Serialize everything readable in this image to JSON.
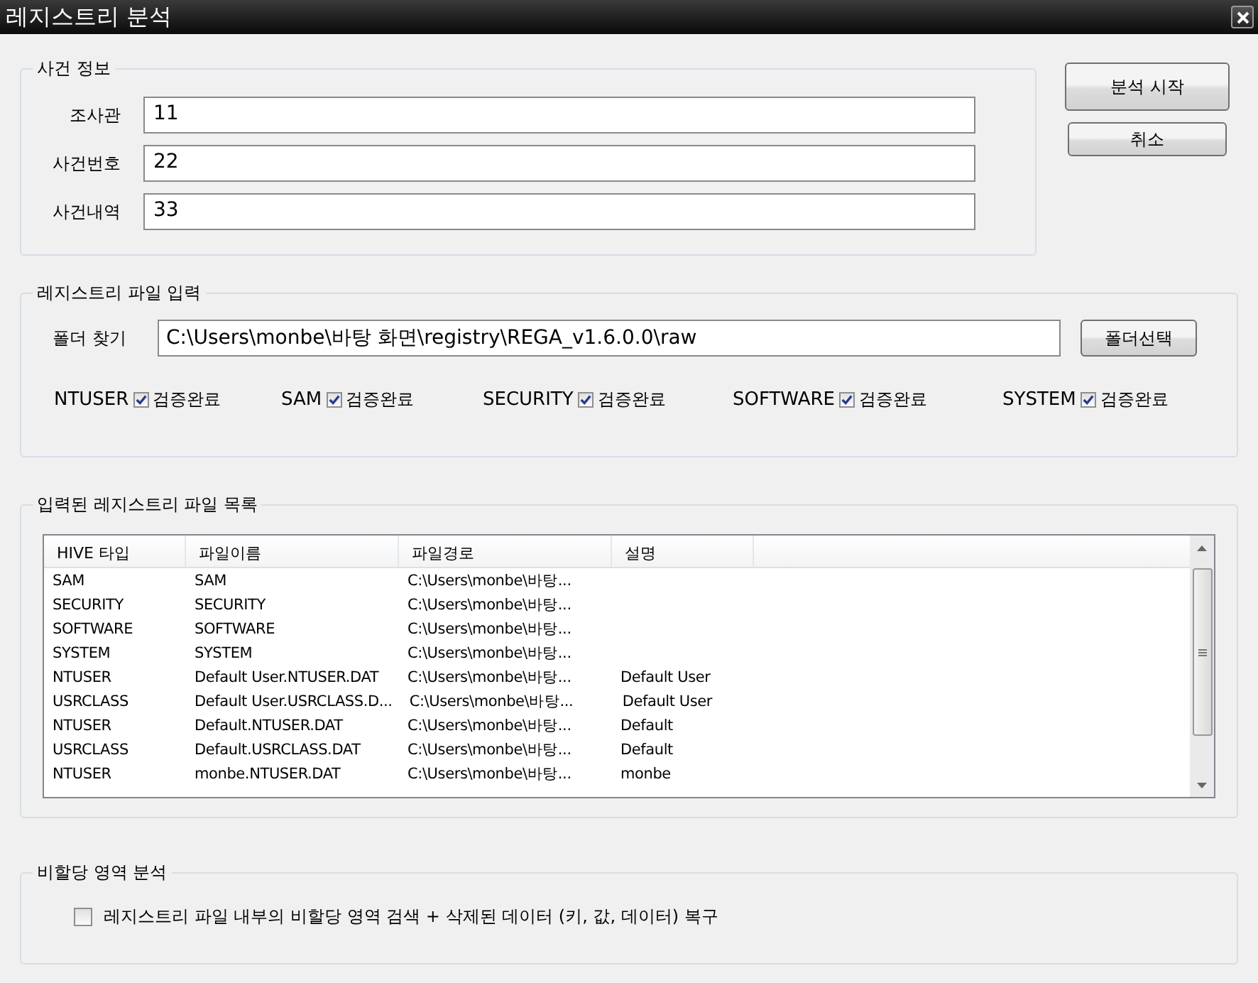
{
  "window": {
    "title": "레지스트리 분석"
  },
  "case_info": {
    "title": "사건 정보",
    "fields": [
      {
        "label": "조사관",
        "value": "11"
      },
      {
        "label": "사건번호",
        "value": "22"
      },
      {
        "label": "사건내역",
        "value": "33"
      }
    ]
  },
  "buttons": [
    {
      "label": "분석 시작"
    },
    {
      "label": "취소"
    }
  ],
  "file_input": {
    "title": "레지스트리 파일 입력",
    "folder_label": "폴더 찾기",
    "folder_value": "C:\\Users\\monbe\\바탕 화면\\registry\\REGA_v1.6.0.0\\raw",
    "folder_button": "폴더선택",
    "hives": [
      {
        "name": "NTUSER",
        "checked": true,
        "check_label": "검증완료"
      },
      {
        "name": "SAM",
        "checked": true,
        "check_label": "검증완료"
      },
      {
        "name": "SECURITY",
        "checked": true,
        "check_label": "검증완료"
      },
      {
        "name": "SOFTWARE",
        "checked": true,
        "check_label": "검증완료"
      },
      {
        "name": "SYSTEM",
        "checked": true,
        "check_label": "검증완료"
      }
    ]
  },
  "file_list": {
    "title": "입력된 레지스트리 파일 목록",
    "columns": [
      "HIVE 타입",
      "파일이름",
      "파일경로",
      "설명"
    ],
    "rows": [
      [
        "SAM",
        "SAM",
        "C:\\Users\\monbe\\바탕...",
        ""
      ],
      [
        "SECURITY",
        "SECURITY",
        "C:\\Users\\monbe\\바탕...",
        ""
      ],
      [
        "SOFTWARE",
        "SOFTWARE",
        "C:\\Users\\monbe\\바탕...",
        ""
      ],
      [
        "SYSTEM",
        "SYSTEM",
        "C:\\Users\\monbe\\바탕...",
        ""
      ],
      [
        "NTUSER",
        "Default User.NTUSER.DAT",
        "C:\\Users\\monbe\\바탕...",
        "Default User"
      ],
      [
        "USRCLASS",
        "Default User.USRCLASS.D...",
        "C:\\Users\\monbe\\바탕...",
        "Default User"
      ],
      [
        "NTUSER",
        "Default.NTUSER.DAT",
        "C:\\Users\\monbe\\바탕...",
        "Default"
      ],
      [
        "USRCLASS",
        "Default.USRCLASS.DAT",
        "C:\\Users\\monbe\\바탕...",
        "Default"
      ],
      [
        "NTUSER",
        "monbe.NTUSER.DAT",
        "C:\\Users\\monbe\\바탕...",
        "monbe"
      ]
    ]
  },
  "unallocated": {
    "title": "비할당 영역 분석",
    "option": {
      "label": "레지스트리 파일 내부의 비할당 영역 검색 + 삭제된 데이터 (키, 값, 데이터) 복구",
      "checked": false
    }
  }
}
